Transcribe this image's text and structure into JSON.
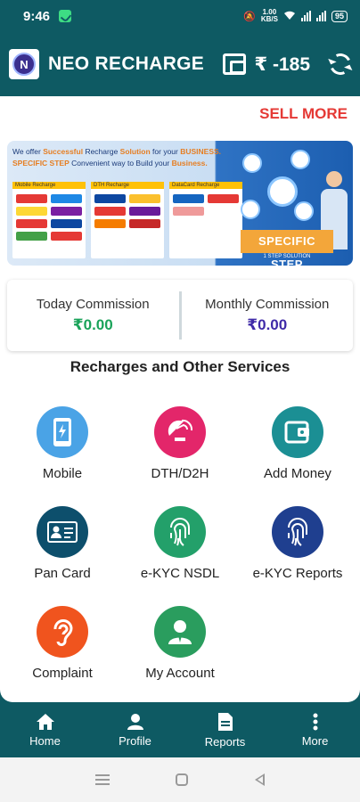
{
  "status_bar": {
    "time": "9:46",
    "speed": "1.00\nKB/S",
    "battery": "95"
  },
  "app_bar": {
    "title": "NEO RECHARGE",
    "balance": "₹ -185",
    "logo_letter": "N"
  },
  "promo": {
    "sell_more_label": "SELL MORE"
  },
  "banner": {
    "line1_a": "We offer ",
    "line1_b": "Successful",
    "line1_c": " Recharge ",
    "line1_d": "Solution",
    "line1_e": " for your ",
    "line1_f": "BUSINESS.",
    "line2_a": "SPECIFIC STEP",
    "line2_b": " Convenient way to Build your ",
    "line2_c": "Business.",
    "panel1": "Mobile Recharge",
    "panel2": "DTH Recharge",
    "panel3": "DataCard Recharge",
    "specific_step": "SPECIFIC STEP",
    "tagline": "1 STEP SOLUTION"
  },
  "commission": {
    "today_label": "Today Commission",
    "today_value": "₹0.00",
    "monthly_label": "Monthly Commission",
    "monthly_value": "₹0.00"
  },
  "services": {
    "title": "Recharges and Other Services",
    "items": [
      {
        "label": "Mobile",
        "icon": "mobile-icon",
        "color": "#4aa3e6"
      },
      {
        "label": "DTH/D2H",
        "icon": "satellite-dish-icon",
        "color": "#e3266a"
      },
      {
        "label": "Add Money",
        "icon": "wallet-icon",
        "color": "#1b8f94"
      },
      {
        "label": "Pan Card",
        "icon": "id-card-icon",
        "color": "#0d4f6c"
      },
      {
        "label": "e-KYC NSDL",
        "icon": "fingerprint-icon",
        "color": "#23a06a"
      },
      {
        "label": "e-KYC Reports",
        "icon": "fingerprint-icon",
        "color": "#1f3f8f"
      },
      {
        "label": "Complaint",
        "icon": "ear-icon",
        "color": "#f0541e"
      },
      {
        "label": "My Account",
        "icon": "user-icon",
        "color": "#2a9d5e"
      }
    ]
  },
  "bottom_nav": {
    "items": [
      {
        "label": "Home",
        "icon": "home-icon"
      },
      {
        "label": "Profile",
        "icon": "person-icon"
      },
      {
        "label": "Reports",
        "icon": "document-icon"
      },
      {
        "label": "More",
        "icon": "more-vert-icon"
      }
    ]
  }
}
